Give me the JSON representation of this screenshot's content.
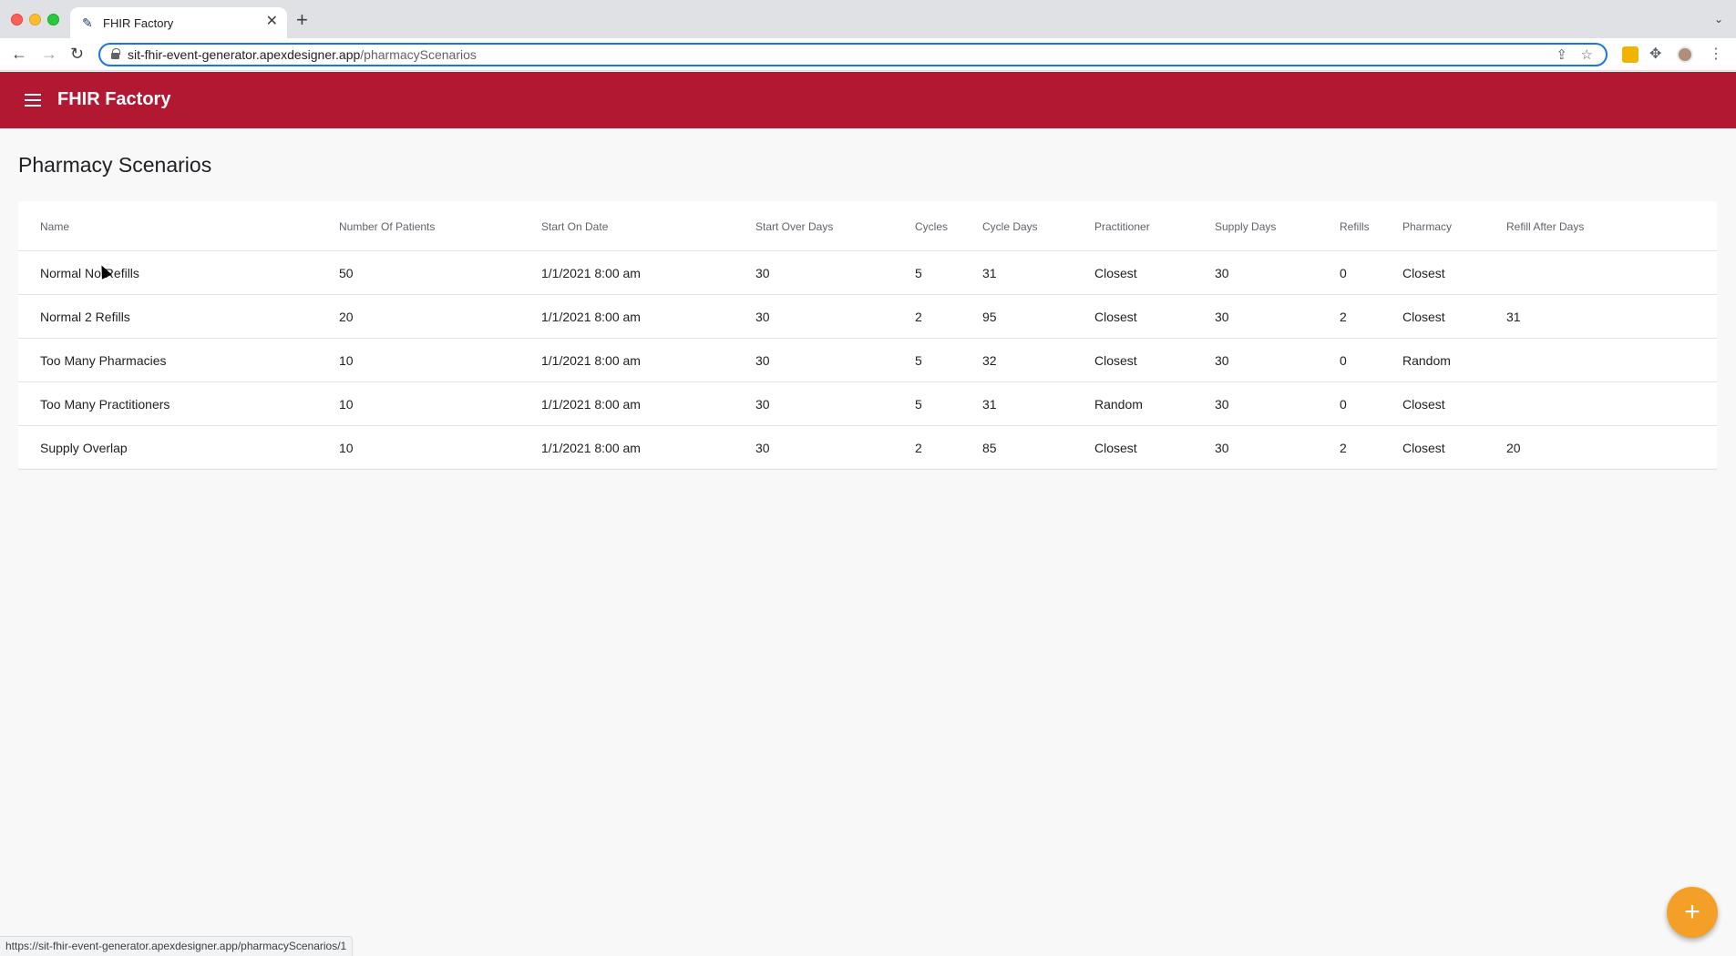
{
  "browser": {
    "tab_title": "FHIR Factory",
    "new_tab_glyph": "+",
    "url_host": "sit-fhir-event-generator.apexdesigner.app",
    "url_path": "/pharmacyScenarios",
    "status_url": "https://sit-fhir-event-generator.apexdesigner.app/pharmacyScenarios/1"
  },
  "app": {
    "title": "FHIR Factory",
    "brand_color": "#b31833",
    "accent_color": "#f4a028"
  },
  "page": {
    "title": "Pharmacy Scenarios"
  },
  "table": {
    "columns": [
      "Name",
      "Number Of Patients",
      "Start On Date",
      "Start Over Days",
      "Cycles",
      "Cycle Days",
      "Practitioner",
      "Supply Days",
      "Refills",
      "Pharmacy",
      "Refill After Days"
    ],
    "rows": [
      [
        "Normal No Refills",
        "50",
        "1/1/2021 8:00 am",
        "30",
        "5",
        "31",
        "Closest",
        "30",
        "0",
        "Closest",
        ""
      ],
      [
        "Normal 2 Refills",
        "20",
        "1/1/2021 8:00 am",
        "30",
        "2",
        "95",
        "Closest",
        "30",
        "2",
        "Closest",
        "31"
      ],
      [
        "Too Many Pharmacies",
        "10",
        "1/1/2021 8:00 am",
        "30",
        "5",
        "32",
        "Closest",
        "30",
        "0",
        "Random",
        ""
      ],
      [
        "Too Many Practitioners",
        "10",
        "1/1/2021 8:00 am",
        "30",
        "5",
        "31",
        "Random",
        "30",
        "0",
        "Closest",
        ""
      ],
      [
        "Supply Overlap",
        "10",
        "1/1/2021 8:00 am",
        "30",
        "2",
        "85",
        "Closest",
        "30",
        "2",
        "Closest",
        "20"
      ]
    ]
  },
  "fab": {
    "label": "+"
  }
}
